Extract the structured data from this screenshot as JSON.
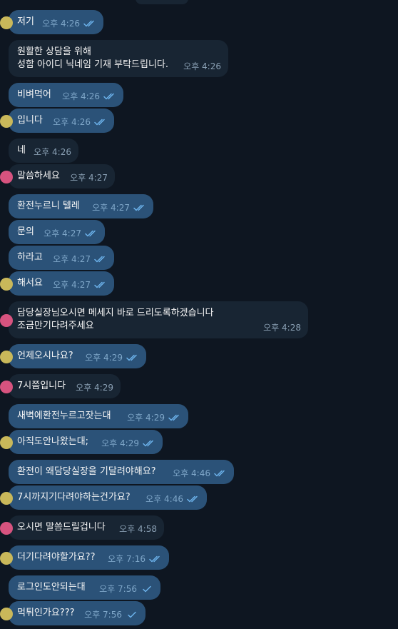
{
  "colors": {
    "background": "#0e1621",
    "incoming_bubble": "#182533",
    "outgoing_bubble": "#2b5278",
    "tick_color": "#6cb2eb",
    "time_color": "#8aa0b4"
  },
  "messages": [
    {
      "text": "저기",
      "time": "오후 4:26",
      "direction": "out",
      "ticks": "double",
      "avatar": "yellow"
    },
    {
      "text": "원활한 상담을 위해\n성함 아이디 닉네임 기재 부탁드립니다.",
      "time": "오후 4:26",
      "direction": "in",
      "ticks": "none",
      "avatar": "none"
    },
    {
      "text": "비벼먹어",
      "time": "오후 4:26",
      "direction": "out",
      "ticks": "double",
      "avatar": "none"
    },
    {
      "text": "입니다",
      "time": "오후 4:26",
      "direction": "out",
      "ticks": "double",
      "avatar": "yellow"
    },
    {
      "text": "네",
      "time": "오후 4:26",
      "direction": "in",
      "ticks": "none",
      "avatar": "none"
    },
    {
      "text": "말씀하세요",
      "time": "오후 4:27",
      "direction": "in",
      "ticks": "none",
      "avatar": "pink"
    },
    {
      "text": "환전누르니 텔레",
      "time": "오후 4:27",
      "direction": "out",
      "ticks": "double",
      "avatar": "none"
    },
    {
      "text": "문의",
      "time": "오후 4:27",
      "direction": "out",
      "ticks": "double",
      "avatar": "none"
    },
    {
      "text": "하라고",
      "time": "오후 4:27",
      "direction": "out",
      "ticks": "double",
      "avatar": "none"
    },
    {
      "text": "해서요",
      "time": "오후 4:27",
      "direction": "out",
      "ticks": "double",
      "avatar": "yellow"
    },
    {
      "text": "담당실장님오시면 메세지 바로 드리도록하겠습니다\n조금만기다려주세요",
      "time": "오후 4:28",
      "direction": "in",
      "ticks": "none",
      "avatar": "pink"
    },
    {
      "text": "언제오시나요?",
      "time": "오후 4:29",
      "direction": "out",
      "ticks": "double",
      "avatar": "yellow"
    },
    {
      "text": "7시쯤입니다",
      "time": "오후 4:29",
      "direction": "in",
      "ticks": "none",
      "avatar": "pink"
    },
    {
      "text": "새벽에환전누르고잣는대",
      "time": "오후 4:29",
      "direction": "out",
      "ticks": "double",
      "avatar": "none"
    },
    {
      "text": "아직도안나왔는대;",
      "time": "오후 4:29",
      "direction": "out",
      "ticks": "double",
      "avatar": "yellow"
    },
    {
      "text": "환전이 왜담당실장을 기달려야해요?",
      "time": "오후 4:46",
      "direction": "out",
      "ticks": "double",
      "avatar": "none"
    },
    {
      "text": "7시까지기다려야하는건가요?",
      "time": "오후 4:46",
      "direction": "out",
      "ticks": "double",
      "avatar": "yellow"
    },
    {
      "text": "오시면 말씀드릴겁니다",
      "time": "오후 4:58",
      "direction": "in",
      "ticks": "none",
      "avatar": "pink"
    },
    {
      "text": "더기다려야할가요??",
      "time": "오후 7:16",
      "direction": "out",
      "ticks": "double",
      "avatar": "yellow"
    },
    {
      "text": "로그인도안되는대",
      "time": "오후 7:56",
      "direction": "out",
      "ticks": "single",
      "avatar": "none"
    },
    {
      "text": "먹튀인가요???",
      "time": "오후 7:56",
      "direction": "out",
      "ticks": "single",
      "avatar": "yellow"
    }
  ]
}
